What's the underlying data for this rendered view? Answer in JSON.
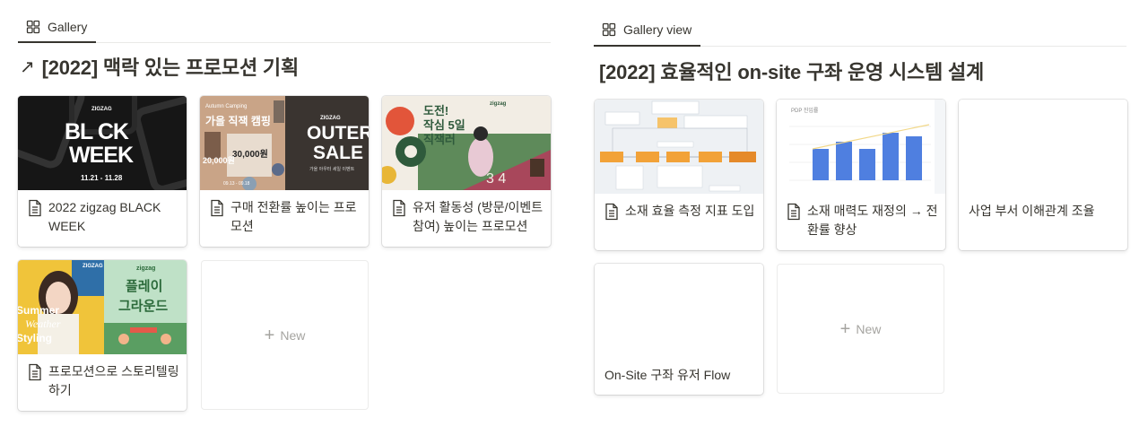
{
  "left": {
    "tab_label": "Gallery",
    "tab_icon": "gallery-grid-icon",
    "title": "[2022] 맥락 있는 프로모션 기획",
    "title_icon": "arrow-up-right-icon",
    "cards": [
      {
        "title": "2022 zigzag BLACK WEEK",
        "cover": {
          "brand": "ZIGZAG",
          "line1": "BL CK",
          "line2": "WEEK",
          "dates": "11.21 - 11.28"
        }
      },
      {
        "title": "구매 전환률 높이는 프로모션",
        "cover": {
          "tag": "Autumn Camping",
          "headline": "가을 직잭 캠핑",
          "brand": "ZIGZAG",
          "big1": "OUTER",
          "big2": "SALE",
          "price1": "30,000원",
          "price2": "20,000원",
          "sub": "가을 아우터 세일 이벤트",
          "dates": "09.13 - 09.18"
        }
      },
      {
        "title": "유저 활동성 (방문/이벤트 참여) 높이는 프로모션",
        "cover": {
          "brand": "zigzag",
          "line1": "도전!",
          "line2": "작심 5일",
          "line3": "직잭러",
          "nums": "3 4"
        }
      },
      {
        "title": "프로모션으로 스토리텔링하기",
        "cover": {
          "brand1": "ZIGZAG",
          "brand2": "zigzag",
          "w1": "Summer",
          "w2": "Weather",
          "w3": "Styling",
          "k1": "플레이",
          "k2": "그라운드"
        }
      }
    ],
    "new_label": "New"
  },
  "right": {
    "tab_label": "Gallery view",
    "tab_icon": "gallery-grid-icon",
    "title": "[2022] 효율적인 on-site 구좌 운영 시스템 설계",
    "cards": [
      {
        "title": "소재 효율 측정 지표 도입"
      },
      {
        "title": "소재 매력도 재정의 → 전환률 향상",
        "chart_label": "PDP 진입률"
      },
      {
        "title": "사업 부서 이해관계 조율"
      },
      {
        "title": "On-Site 구좌 유저 Flow"
      }
    ],
    "new_label": "New"
  },
  "colors": {
    "text": "#37352f",
    "muted": "#a5a4a0",
    "divider": "#e9e9e7",
    "bar_blue": "#4f7fe0"
  }
}
